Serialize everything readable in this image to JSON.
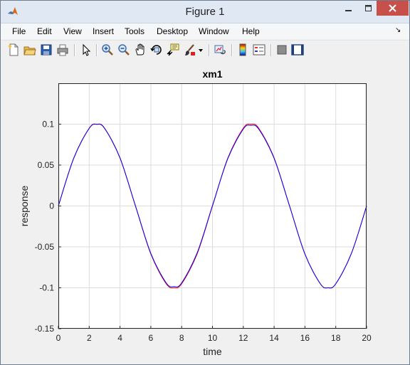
{
  "window": {
    "title": "Figure 1",
    "menu": [
      "File",
      "Edit",
      "View",
      "Insert",
      "Tools",
      "Desktop",
      "Window",
      "Help"
    ]
  },
  "toolbar": {
    "icons": [
      "new-figure-icon",
      "open-file-icon",
      "save-icon",
      "print-icon",
      "pointer-icon",
      "zoom-in-icon",
      "zoom-out-icon",
      "pan-hand-icon",
      "rotate-3d-icon",
      "data-cursor-icon",
      "brush-icon",
      "brush-dropdown-icon",
      "link-plot-icon",
      "colorbar-icon",
      "legend-icon",
      "hide-plot-tools-icon",
      "show-plot-tools-icon"
    ]
  },
  "colors": {
    "series_blue": "#0000ff",
    "series_red": "#ff0000",
    "close_button": "#c7504a"
  },
  "chart_data": {
    "type": "line",
    "title": "xm1",
    "xlabel": "time",
    "ylabel": "response",
    "xlim": [
      0,
      20
    ],
    "ylim": [
      -0.15,
      0.15
    ],
    "xticks": [
      "0",
      "2",
      "4",
      "6",
      "8",
      "10",
      "12",
      "14",
      "16",
      "18",
      "20"
    ],
    "yticks": [
      "-0.15",
      "-0.1",
      "-0.05",
      "0",
      "0.05",
      "0.1"
    ],
    "grid": true,
    "series": [
      {
        "color": "#ff0000",
        "x": [
          0,
          1,
          2,
          2.5,
          3,
          4,
          5,
          6,
          7,
          7.5,
          8,
          9,
          10,
          11,
          12,
          12.5,
          13,
          14,
          15,
          16,
          17,
          17.5,
          18,
          19,
          20
        ],
        "y": [
          0,
          0.0588,
          0.0951,
          0.1,
          0.0951,
          0.0588,
          0,
          -0.0588,
          -0.0951,
          -0.1,
          -0.0951,
          -0.0588,
          0,
          0.0588,
          0.0951,
          0.1,
          0.0951,
          0.0588,
          0,
          -0.0588,
          -0.0951,
          -0.1,
          -0.0951,
          -0.0588,
          0
        ]
      },
      {
        "color": "#0000ff",
        "x": [
          0,
          1,
          2,
          2.5,
          3,
          4,
          5,
          6,
          7,
          7.5,
          8,
          9,
          10,
          11,
          12,
          12.5,
          13,
          14,
          15,
          16,
          17,
          17.5,
          18,
          19,
          20
        ],
        "y": [
          0,
          0.0585,
          0.0948,
          0.0997,
          0.0948,
          0.0586,
          0.0002,
          -0.058,
          -0.094,
          -0.0985,
          -0.094,
          -0.0575,
          0.0005,
          0.058,
          0.094,
          0.0985,
          0.094,
          0.0582,
          0,
          -0.0588,
          -0.0951,
          -0.1,
          -0.0951,
          -0.0588,
          0
        ]
      }
    ]
  }
}
